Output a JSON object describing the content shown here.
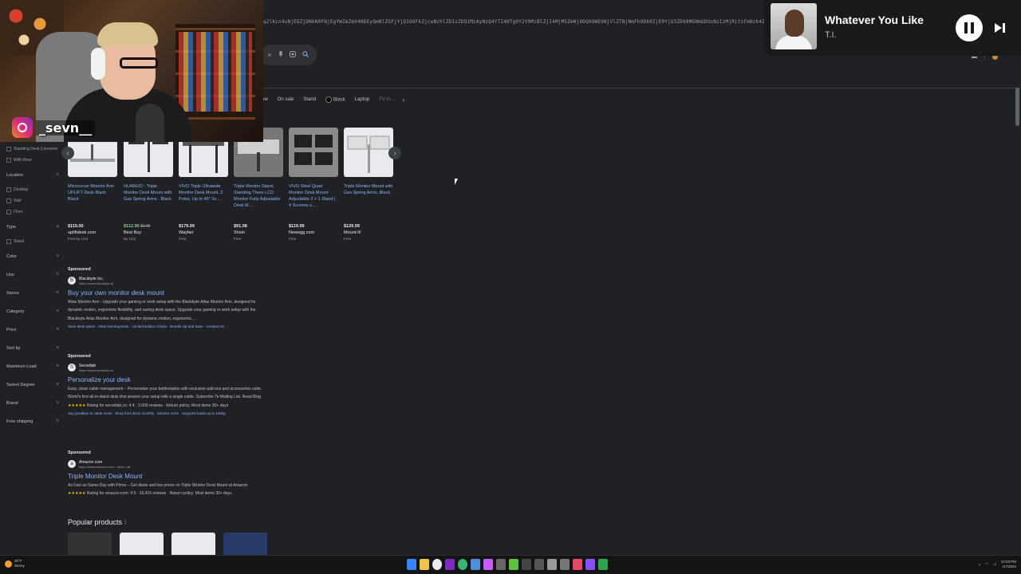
{
  "browser": {
    "url_text": "q2lkLn4sNjEQZjDNkN0FNjEgYWZmZmV4NDEyQmNlZGFjYjQ1OGFkZjcwNzhlZDIzZDQ1MzAyNzQ4YTI4NTg0Y2Y0MzBlZjI4MjM5ZmNjODQ0OWE0NjVlZTNjNmFhODk0ZjE0YjU3ZDk0MGNmODUxNzIzMjRiYzFmNzk4ZTRhZTNmMDg2MjdiMzM1NGI0ZmQ2ZjQ2YmQ0NmE0YzUzMGVkZDk5YjJiMzRiNDIxZGE2"
  },
  "search": {
    "clear_icon": "×",
    "mic_icon": "mic-icon",
    "lens_icon": "lens-icon",
    "search_icon": "search-icon"
  },
  "chips": [
    "ew",
    "On sale",
    "Stand",
    "Black",
    "Laptop",
    "TV m…"
  ],
  "sidebar": {
    "top_items": [
      "Standing Desk Converter",
      "With Riser"
    ],
    "location": {
      "label": "Location",
      "items": [
        "Desktop",
        "Wall",
        "Floor"
      ]
    },
    "type": {
      "label": "Type",
      "items": [
        "Stand"
      ]
    },
    "collapsed": [
      "Color",
      "Use",
      "Stores",
      "Category",
      "Price",
      "Sort by",
      "Maximum Load",
      "Swivel Degree",
      "Brand",
      "Free shipping"
    ]
  },
  "products": [
    {
      "title": "Microcover Monitor Arm UPLIFT Desk Black Black",
      "price": "$119.00",
      "old_price": "",
      "store": "upliftdesk.com",
      "ship": "Free by 1/14"
    },
    {
      "title": "HUANUO - Triple Monitor Desk Mount with Gas Spring Arms - Black",
      "price": "$112.99",
      "old_price": "$149",
      "store": "Best Buy",
      "ship": "By 1/22"
    },
    {
      "title": "VIVO Triple Ultrawide Monitor Desk Mount, 2 Poles, Up to 49\" Sc…",
      "price": "$179.99",
      "old_price": "",
      "store": "Wayfair",
      "ship": "Free"
    },
    {
      "title": "Triple Monitor Stand, Standing Three LCD Monitor Fully Adjustable Desk M…",
      "price": "$91.08",
      "old_price": "",
      "store": "Shein",
      "ship": "Free"
    },
    {
      "title": "VIVO Steel Quad Monitor Desk Mount Adjustable 3 + 1 Stand | 4 Screens u…",
      "price": "$119.99",
      "old_price": "",
      "store": "Newegg.com",
      "ship": "Free"
    },
    {
      "title": "Triple Monitor Mount with Gas Spring Arms, Black",
      "price": "$129.99",
      "old_price": "",
      "store": "Mount-It!",
      "ship": "Free"
    }
  ],
  "ads": [
    {
      "sponsored": "Sponsored",
      "logo": "B",
      "name": "Blackbyte Inc.",
      "url": "https://www.blackbyte.ai",
      "title": "Buy your own monitor desk mount",
      "desc": "Atlas Monitor Arm - Upgrade your gaming or work setup with the Blackbyte Atlas Monitor Arm, designed for dynamic motion, ergonomic flexibility, and saving desk space. Upgrade your gaming or work setup with the Blackbyte Atlas Monitor Arm, designed for dynamic motion, ergonomic…",
      "rating": "",
      "links": "Save desk space · Atlas Gaming Desk · Limited Edition Chairs · Bundle Up and Save · Contact Us"
    },
    {
      "sponsored": "Sponsored",
      "logo": "S",
      "name": "Secretlab",
      "url": "https://www.secretlab.co",
      "title": "Personalize your desk",
      "desc": "Easy, clean cable management – Personalize your battlestation with exclusive add-ons and accessories suite. World's first all-in-stand desk that powers your setup with a single cable. Subscribe To Mailing List. Read Blog",
      "rating": "Rating for secretlab.co: 4.4 · 2,000 reviews · Return policy: Most items 30+ days",
      "links": "Say goodbye to cable mess · Shop from $134 monthly · Monitor Arms · Supports loads up to 100kg"
    },
    {
      "sponsored": "Sponsored",
      "logo": "a",
      "name": "Amazon.com",
      "url": "https://www.amazon.com › shop › all",
      "title": "Triple Monitor Desk Mount",
      "desc": "As Fast as Same-Day with Prime – Get deals and low prices on Triple Monitor Desk Mount at Amazon",
      "rating": "Rating for amazon.com: 4.5 · 16,415 reviews · Return policy: Most items 30+ days",
      "links": ""
    }
  ],
  "popular": {
    "label": "Popular products"
  },
  "overlay": {
    "instagram_handle": "_sevn__"
  },
  "music": {
    "song": "Whatever You Like",
    "artist": "T.I."
  },
  "taskbar": {
    "temp": "30°F",
    "weather": "Sunny",
    "time": "12:03 PM",
    "date": "1/7/2024"
  },
  "colors": {
    "background": "#202124",
    "link": "#8ab4f8",
    "price": "#e8eaed",
    "sale": "#81c995"
  }
}
